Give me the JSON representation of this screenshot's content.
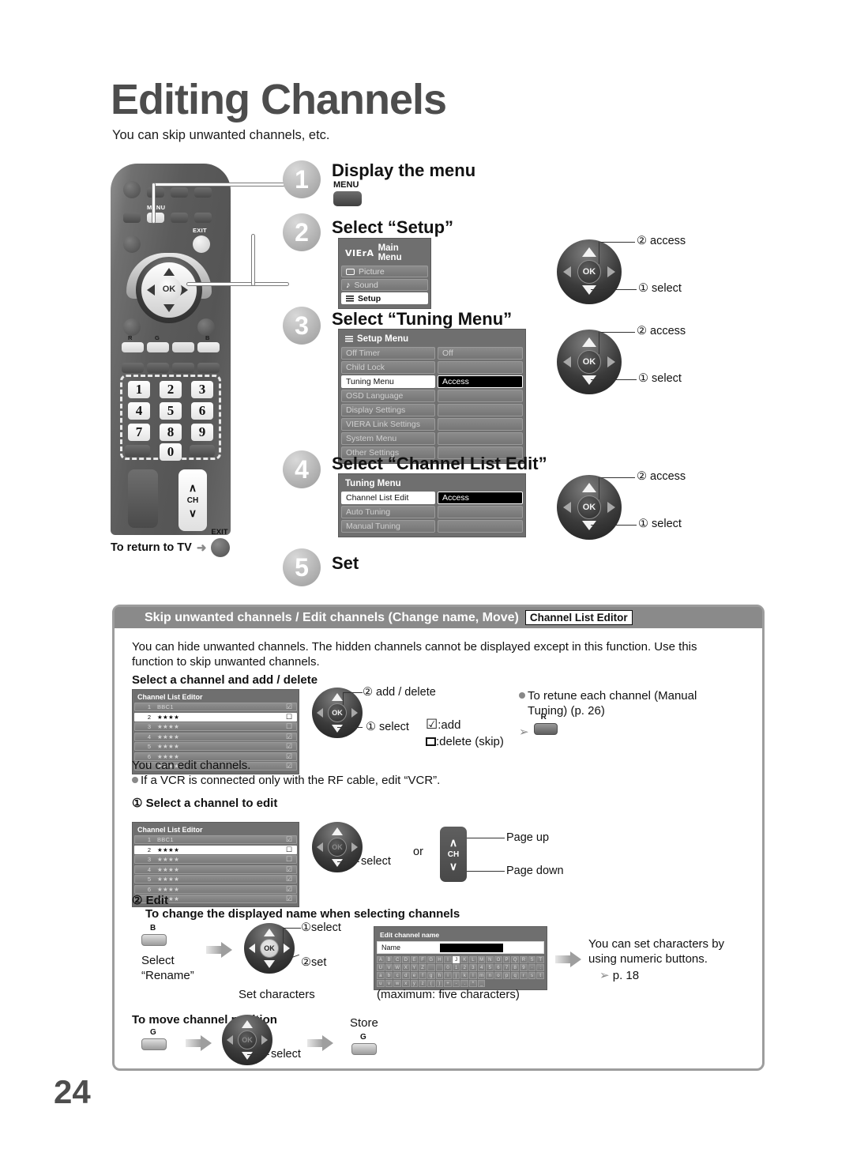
{
  "header": {
    "title": "Editing Channels",
    "subtitle": "You can skip unwanted channels, etc.",
    "page_number": "24"
  },
  "remote": {
    "menu_label": "MENU",
    "exit_label": "EXIT",
    "ok_label": "OK",
    "color_r": "R",
    "color_g": "G",
    "color_b": "B",
    "ch_label": "CH",
    "keys": [
      "1",
      "2",
      "3",
      "4",
      "5",
      "6",
      "7",
      "8",
      "9",
      "0"
    ],
    "return_to_tv": "To return to TV",
    "return_arrow": "➜",
    "return_button_label": "EXIT"
  },
  "steps": [
    {
      "n": "1",
      "title": "Display the menu",
      "button_label": "MENU"
    },
    {
      "n": "2",
      "title": "Select “Setup”"
    },
    {
      "n": "3",
      "title": "Select “Tuning Menu”"
    },
    {
      "n": "4",
      "title": "Select “Channel List Edit”"
    },
    {
      "n": "5",
      "title": "Set"
    }
  ],
  "main_menu": {
    "logo": "VIErA",
    "title": "Main Menu",
    "items": [
      {
        "label": "Picture",
        "icon": "picture-icon",
        "selected": false
      },
      {
        "label": "Sound",
        "icon": "note-icon",
        "selected": false
      },
      {
        "label": "Setup",
        "icon": "list-icon",
        "selected": true
      }
    ]
  },
  "setup_menu": {
    "title": "Setup Menu",
    "icon": "list-icon",
    "rows": [
      {
        "label": "Off Timer",
        "value": "Off",
        "selected": false
      },
      {
        "label": "Child Lock",
        "value": "",
        "selected": false
      },
      {
        "label": "Tuning Menu",
        "value": "Access",
        "selected": true
      },
      {
        "label": "OSD Language",
        "value": "",
        "selected": false
      },
      {
        "label": "Display Settings",
        "value": "",
        "selected": false
      },
      {
        "label": "VIERA Link Settings",
        "value": "",
        "selected": false
      },
      {
        "label": "System Menu",
        "value": "",
        "selected": false
      },
      {
        "label": "Other Settings",
        "value": "",
        "selected": false
      }
    ]
  },
  "tuning_menu": {
    "title": "Tuning Menu",
    "rows": [
      {
        "label": "Channel List Edit",
        "value": "Access",
        "selected": true
      },
      {
        "label": "Auto Tuning",
        "value": "",
        "selected": false
      },
      {
        "label": "Manual Tuning",
        "value": "",
        "selected": false
      }
    ]
  },
  "nav_callouts": {
    "access": "② access",
    "select": "① select",
    "add_delete": "② add / delete",
    "select_plain": "select",
    "select1": "①select",
    "set2": "②set",
    "ok": "OK"
  },
  "panel": {
    "heading": "Skip unwanted channels / Edit channels (Change name, Move)",
    "heading_tag": "Channel List Editor",
    "intro_line1": "You can hide unwanted channels. The hidden channels cannot be displayed except in this function. Use this",
    "intro_line2": "function to skip unwanted channels.",
    "subhead_add_delete": "Select a channel and add / delete",
    "legend_add": ":add",
    "legend_delete": ":delete (skip)",
    "retune_line1": "To retune each channel (Manual",
    "retune_line2": "Tuning) (p. 26)",
    "retune_button": "R",
    "edit_line1": "You can edit channels.",
    "edit_line2": "If a VCR is connected only with the RF cable, edit “VCR”.",
    "step1_label": "① Select a channel to edit",
    "or_label": "or",
    "page_up": "Page up",
    "page_down": "Page down",
    "ch_label": "CH",
    "step2_label": "② Edit",
    "step2_sub": "To change the displayed name when selecting channels",
    "select_rename_l1": "Select",
    "select_rename_l2": "“Rename”",
    "select_rename_button": "B",
    "set_characters": "Set characters",
    "max_chars": "(maximum: five characters)",
    "numeric_note_l1": "You can set characters by",
    "numeric_note_l2": "using numeric buttons.",
    "numeric_note_page": "p. 18",
    "move_heading": "To move channel position",
    "move_button": "G",
    "store_label": "Store",
    "store_button": "G"
  },
  "channel_list_editor": {
    "title": "Channel List Editor",
    "rows": [
      {
        "num": "1",
        "name": "BBC1",
        "mark": "check",
        "selected": false
      },
      {
        "num": "2",
        "name": "★★★★",
        "mark": "box",
        "selected": true
      },
      {
        "num": "3",
        "name": "★★★★",
        "mark": "box",
        "selected": false
      },
      {
        "num": "4",
        "name": "★★★★",
        "mark": "check",
        "selected": false
      },
      {
        "num": "5",
        "name": "★★★★",
        "mark": "check",
        "selected": false
      },
      {
        "num": "6",
        "name": "★★★★",
        "mark": "check",
        "selected": false
      },
      {
        "num": "7",
        "name": "★★★★",
        "mark": "check",
        "selected": false
      }
    ]
  },
  "channel_list_editor2": {
    "title": "Channel List Editor",
    "rows": [
      {
        "num": "1",
        "name": "BBC1",
        "mark": "check",
        "selected": false
      },
      {
        "num": "2",
        "name": "★★★★",
        "mark": "box",
        "selected": true
      },
      {
        "num": "3",
        "name": "★★★★",
        "mark": "box",
        "selected": false
      },
      {
        "num": "4",
        "name": "★★★★",
        "mark": "check",
        "selected": false
      },
      {
        "num": "5",
        "name": "★★★★",
        "mark": "check",
        "selected": false
      },
      {
        "num": "6",
        "name": "★★★★",
        "mark": "check",
        "selected": false
      },
      {
        "num": "7",
        "name": "★★★★",
        "mark": "check",
        "selected": false
      }
    ]
  },
  "edit_channel_name": {
    "title": "Edit channel name",
    "name_label": "Name",
    "keyboard": [
      [
        "A",
        "B",
        "C",
        "D",
        "E",
        "F",
        "G",
        "H",
        "I",
        "J",
        "K",
        "L",
        "M",
        "N",
        "O",
        "P",
        "Q",
        "R",
        "S",
        "T"
      ],
      [
        "U",
        "V",
        "W",
        "X",
        "Y",
        "Z",
        "",
        "",
        "0",
        "1",
        "2",
        "3",
        "4",
        "5",
        "6",
        "7",
        "8",
        "9",
        "·",
        ":"
      ],
      [
        "a",
        "b",
        "c",
        "d",
        "e",
        "f",
        "g",
        "h",
        "i",
        "j",
        "k",
        "l",
        "m",
        "n",
        "o",
        "p",
        "q",
        "r",
        "s",
        "t"
      ],
      [
        "u",
        "v",
        "w",
        "x",
        "y",
        "z",
        "(",
        ")",
        "+",
        "-",
        ".",
        "*",
        "_",
        "",
        "",
        "",
        "",
        "",
        "",
        ""
      ]
    ],
    "selected_key": "J"
  },
  "colors": {
    "title_gray": "#4d4d4d",
    "panel_head": "#8a8a8a",
    "osd_bg": "#6f6f6f",
    "osd_row": "#808080",
    "highlight_white": "#ffffff",
    "access_black": "#000000"
  }
}
